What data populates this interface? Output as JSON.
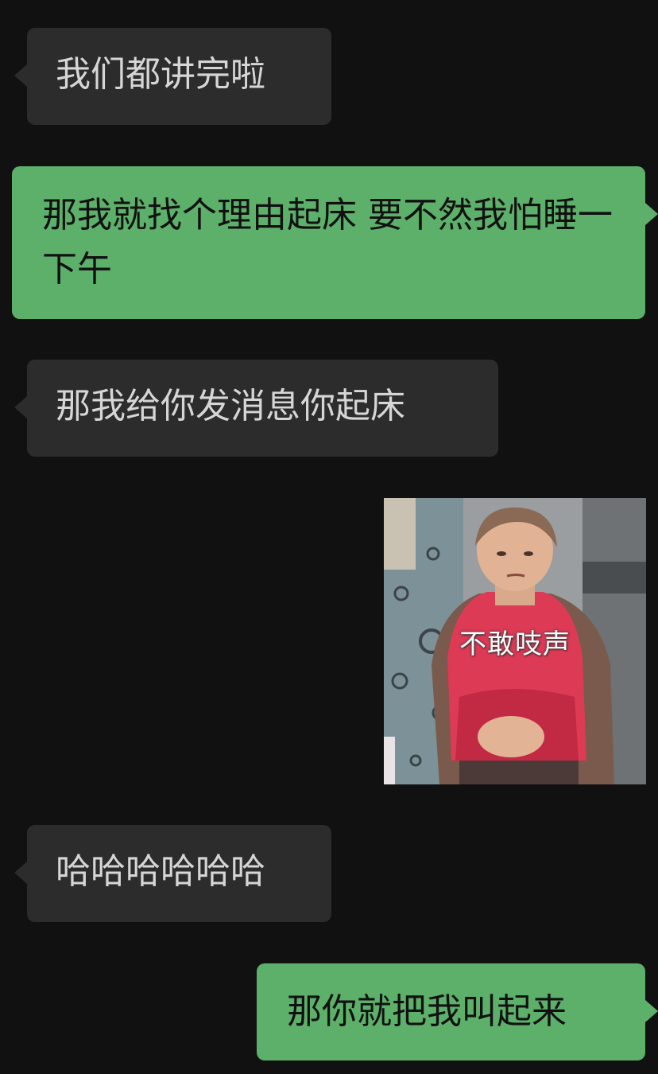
{
  "chat": {
    "messages": [
      {
        "direction": "incoming",
        "type": "text",
        "text": "我们都讲完啦"
      },
      {
        "direction": "outgoing",
        "type": "text",
        "text": "那我就找个理由起床 要不然我怕睡一下午"
      },
      {
        "direction": "incoming",
        "type": "text",
        "text": "那我给你发消息你起床"
      },
      {
        "direction": "outgoing",
        "type": "sticker",
        "caption": "不敢吱声"
      },
      {
        "direction": "incoming",
        "type": "text",
        "text": "哈哈哈哈哈哈"
      },
      {
        "direction": "outgoing",
        "type": "text",
        "text": "那你就把我叫起来"
      }
    ]
  },
  "colors": {
    "background": "#111111",
    "incoming_bubble": "#2c2c2c",
    "incoming_text": "#d6d6d6",
    "outgoing_bubble": "#5db06a",
    "outgoing_text": "#111111"
  }
}
